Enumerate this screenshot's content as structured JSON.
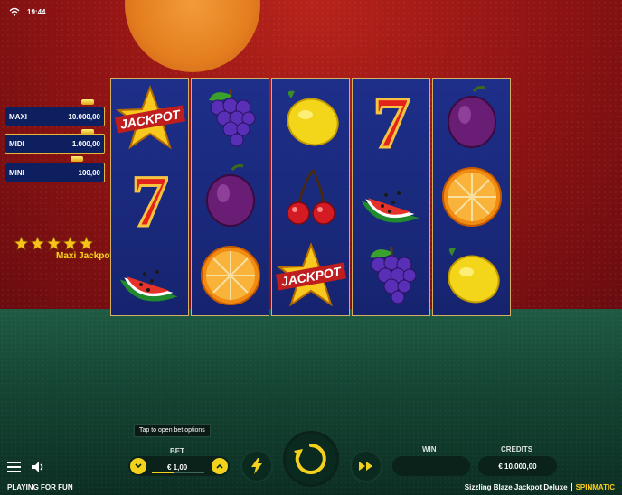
{
  "status_bar": {
    "time": "19:44",
    "wifi_icon": "wifi-icon"
  },
  "jackpots": [
    {
      "name": "MAXI",
      "value": "10.000,00"
    },
    {
      "name": "MIDI",
      "value": "1.000,00"
    },
    {
      "name": "MINI",
      "value": "100,00"
    }
  ],
  "stars_label": "Maxi Jackpot",
  "reels": [
    [
      "jackpot",
      "seven",
      "watermelon"
    ],
    [
      "grapes",
      "plum",
      "orange"
    ],
    [
      "lemon",
      "cherries",
      "jackpot"
    ],
    [
      "seven",
      "watermelon",
      "grapes"
    ],
    [
      "plum",
      "orange",
      "lemon"
    ]
  ],
  "symbols": {
    "jackpot_text": "JACKPOT",
    "seven_text": "7"
  },
  "controls": {
    "tooltip": "Tap to open bet options",
    "bet_label": "BET",
    "bet_value": "€ 1,00",
    "bet_fill": 0.43,
    "win_label": "WIN",
    "win_value": "",
    "credits_label": "CREDITS",
    "credits_value": "€ 10.000,00"
  },
  "footer": {
    "mode": "PLAYING FOR FUN",
    "game_title": "Sizzling Blaze Jackpot Deluxe",
    "brand": "SPINMATIC"
  },
  "colors": {
    "accent": "#f2d21c",
    "reel_bg": "#1e2f8a",
    "panel_border": "#e8b632"
  }
}
